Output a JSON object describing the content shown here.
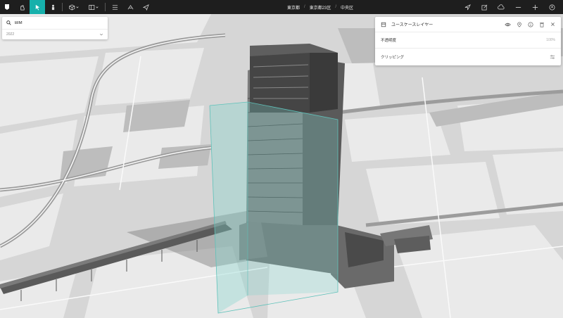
{
  "topbar": {
    "breadcrumb": [
      "東京都",
      "東京都23区",
      "中央区"
    ],
    "tools": [
      "pointer-tool",
      "select-tool",
      "person-tool",
      "cube-tool",
      "layout-tool",
      "list-tool",
      "story-tool",
      "send-tool"
    ]
  },
  "search": {
    "value": "BIM",
    "year": "2022"
  },
  "layer_panel": {
    "title": "ユースケースレイヤー",
    "opacity_label": "不透明度",
    "opacity_value": "100%",
    "clipping_label": "クリッピング"
  },
  "colors": {
    "accent": "#16b0ab",
    "toolbar_bg": "#1e1e1e",
    "clip_box": "#7fd3cc"
  }
}
